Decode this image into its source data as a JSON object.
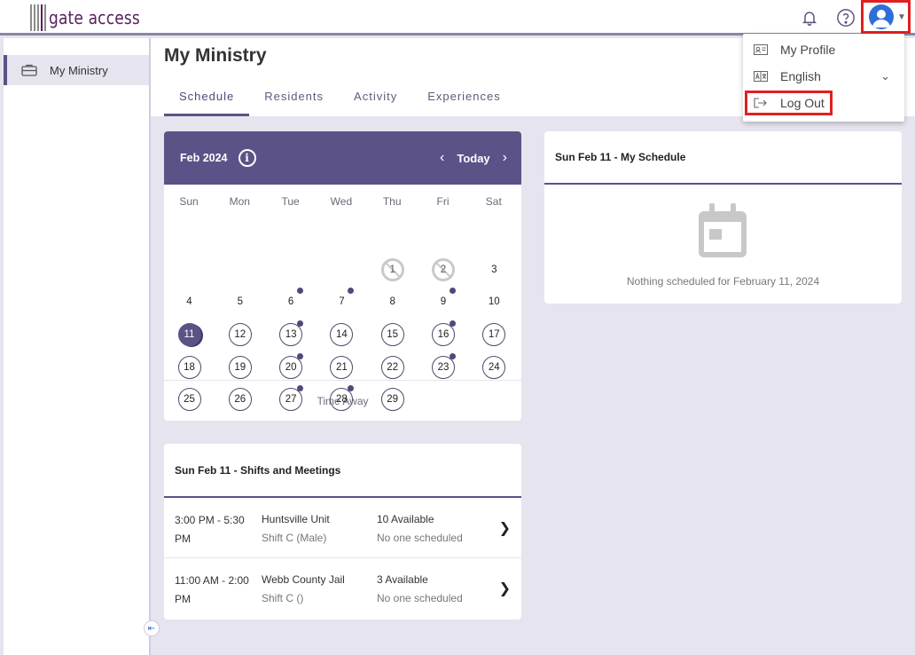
{
  "app": {
    "logo_text": "gate access"
  },
  "colors": {
    "accent": "#5b5287",
    "highlight": "#e02020",
    "avatar": "#2d6fd6"
  },
  "topbar": {
    "icons": [
      "bell-icon",
      "help-icon",
      "user-avatar-icon"
    ]
  },
  "sidebar": {
    "items": [
      {
        "label": "My Ministry",
        "icon": "briefcase-icon"
      }
    ]
  },
  "page": {
    "title": "My Ministry"
  },
  "tabs": [
    {
      "label": "Schedule",
      "active": true
    },
    {
      "label": "Residents",
      "active": false
    },
    {
      "label": "Activity",
      "active": false
    },
    {
      "label": "Experiences",
      "active": false
    }
  ],
  "calendar": {
    "month_label": "Feb 2024",
    "info_glyph": "i",
    "today_label": "Today",
    "weekdays": [
      "Sun",
      "Mon",
      "Tue",
      "Wed",
      "Thu",
      "Fri",
      "Sat"
    ],
    "first_weekday": 4,
    "days_in_month": 29,
    "selected_day": 11,
    "past_days": [
      1,
      2
    ],
    "plain_days": [
      3,
      4,
      5,
      6,
      7,
      8,
      9,
      10
    ],
    "event_dots": [
      6,
      7,
      9,
      13,
      16,
      20,
      23,
      27,
      28
    ],
    "time_away_label": "Time Away"
  },
  "shifts": {
    "title": "Sun Feb 11 - Shifts and Meetings",
    "rows": [
      {
        "time": "3:00 PM - 5:30 PM",
        "location": "Huntsville Unit",
        "shift": "Shift C (Male)",
        "available": "10 Available",
        "scheduled": "No one scheduled"
      },
      {
        "time": "11:00 AM - 2:00 PM",
        "location": "Webb County Jail",
        "shift": "Shift C ()",
        "available": "3 Available",
        "scheduled": "No one scheduled"
      }
    ]
  },
  "schedule": {
    "title": "Sun Feb 11 - My Schedule",
    "empty_text": "Nothing scheduled for February 11, 2024"
  },
  "user_menu": {
    "items": [
      {
        "label": "My Profile",
        "icon": "profile-card-icon"
      },
      {
        "label": "English",
        "icon": "language-icon"
      },
      {
        "label": "Log Out",
        "icon": "logout-icon"
      }
    ]
  }
}
